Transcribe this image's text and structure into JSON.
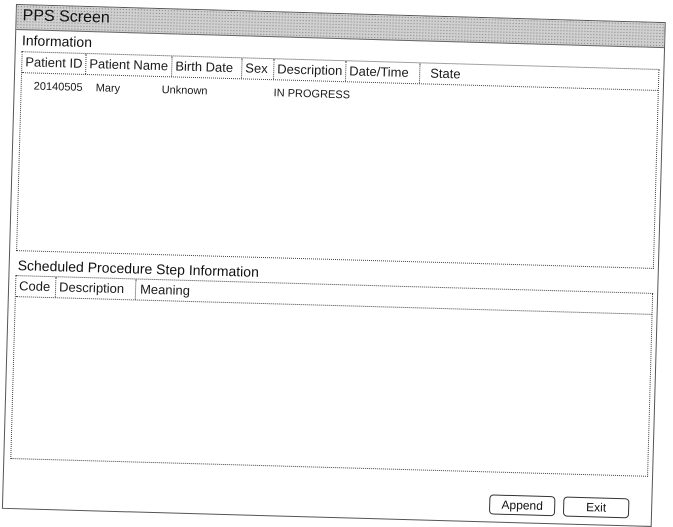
{
  "window": {
    "title": "PPS Screen"
  },
  "information": {
    "label": "Information",
    "columns": [
      "Patient ID",
      "Patient Name",
      "Birth Date",
      "Sex",
      "Description",
      "Date/Time",
      "State"
    ],
    "rows": [
      {
        "patient_id": "20140505",
        "patient_name": "Mary",
        "birth_date": "Unknown",
        "sex": "",
        "description": "IN PROGRESS",
        "date_time": "",
        "state": ""
      }
    ]
  },
  "scheduled": {
    "label": "Scheduled Procedure Step Information",
    "columns": [
      "Code",
      "Description",
      "Meaning"
    ]
  },
  "buttons": {
    "append": "Append",
    "exit": "Exit"
  }
}
